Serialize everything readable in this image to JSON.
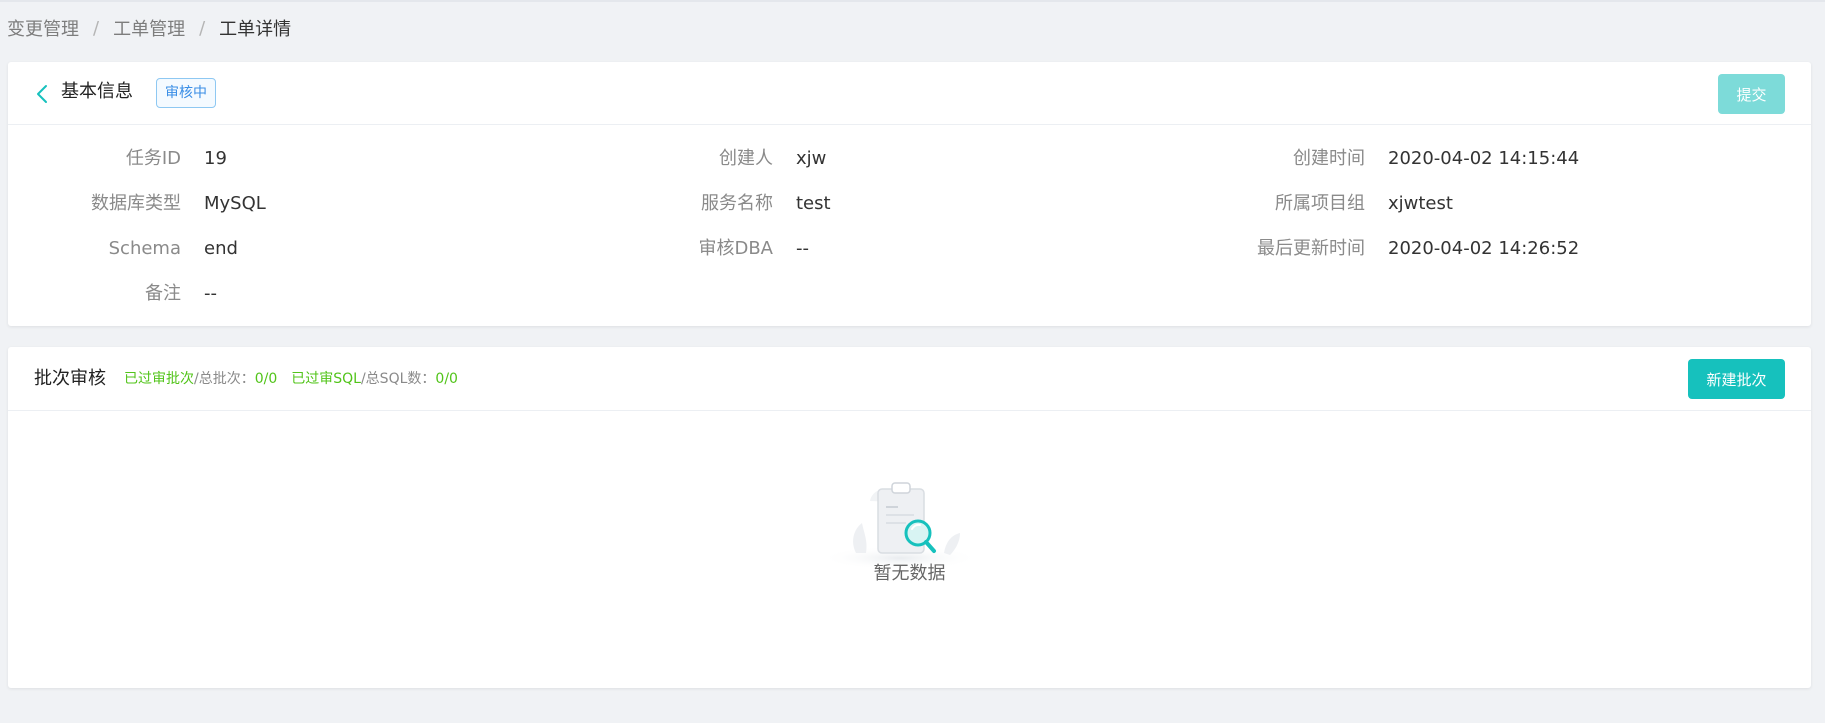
{
  "breadcrumb": {
    "items": [
      "变更管理",
      "工单管理",
      "工单详情"
    ],
    "separator": "/"
  },
  "info_card": {
    "title": "基本信息",
    "status": "审核中",
    "submit_label": "提交",
    "fields": {
      "task_id": {
        "label": "任务ID",
        "value": "19"
      },
      "creator": {
        "label": "创建人",
        "value": "xjw"
      },
      "created_time": {
        "label": "创建时间",
        "value": "2020-04-02 14:15:44"
      },
      "db_type": {
        "label": "数据库类型",
        "value": "MySQL"
      },
      "service_name": {
        "label": "服务名称",
        "value": "test"
      },
      "project_group": {
        "label": "所属项目组",
        "value": "xjwtest"
      },
      "schema": {
        "label": "Schema",
        "value": "end"
      },
      "reviewer_dba": {
        "label": "审核DBA",
        "value": "--"
      },
      "updated_time": {
        "label": "最后更新时间",
        "value": "2020-04-02 14:26:52"
      },
      "remark": {
        "label": "备注",
        "value": "--"
      }
    }
  },
  "batch_card": {
    "title": "批次审核",
    "stats": {
      "passed_batches_label": "已过审批次",
      "total_batches_label": "/总批次：",
      "batches_value": "0/0",
      "passed_sql_label": "已过审SQL",
      "total_sql_label": "/总SQL数：",
      "sql_value": "0/0"
    },
    "new_batch_label": "新建批次",
    "empty_text": "暂无数据"
  },
  "colors": {
    "accent": "#16c1bd",
    "accent_disabled": "#7ddbd9",
    "status_blue": "#3a8ee6",
    "success_green": "#52c41a",
    "background": "#f0f2f5"
  },
  "icons": {
    "back": "chevron-left-icon",
    "empty": "empty-clipboard-search-icon"
  }
}
